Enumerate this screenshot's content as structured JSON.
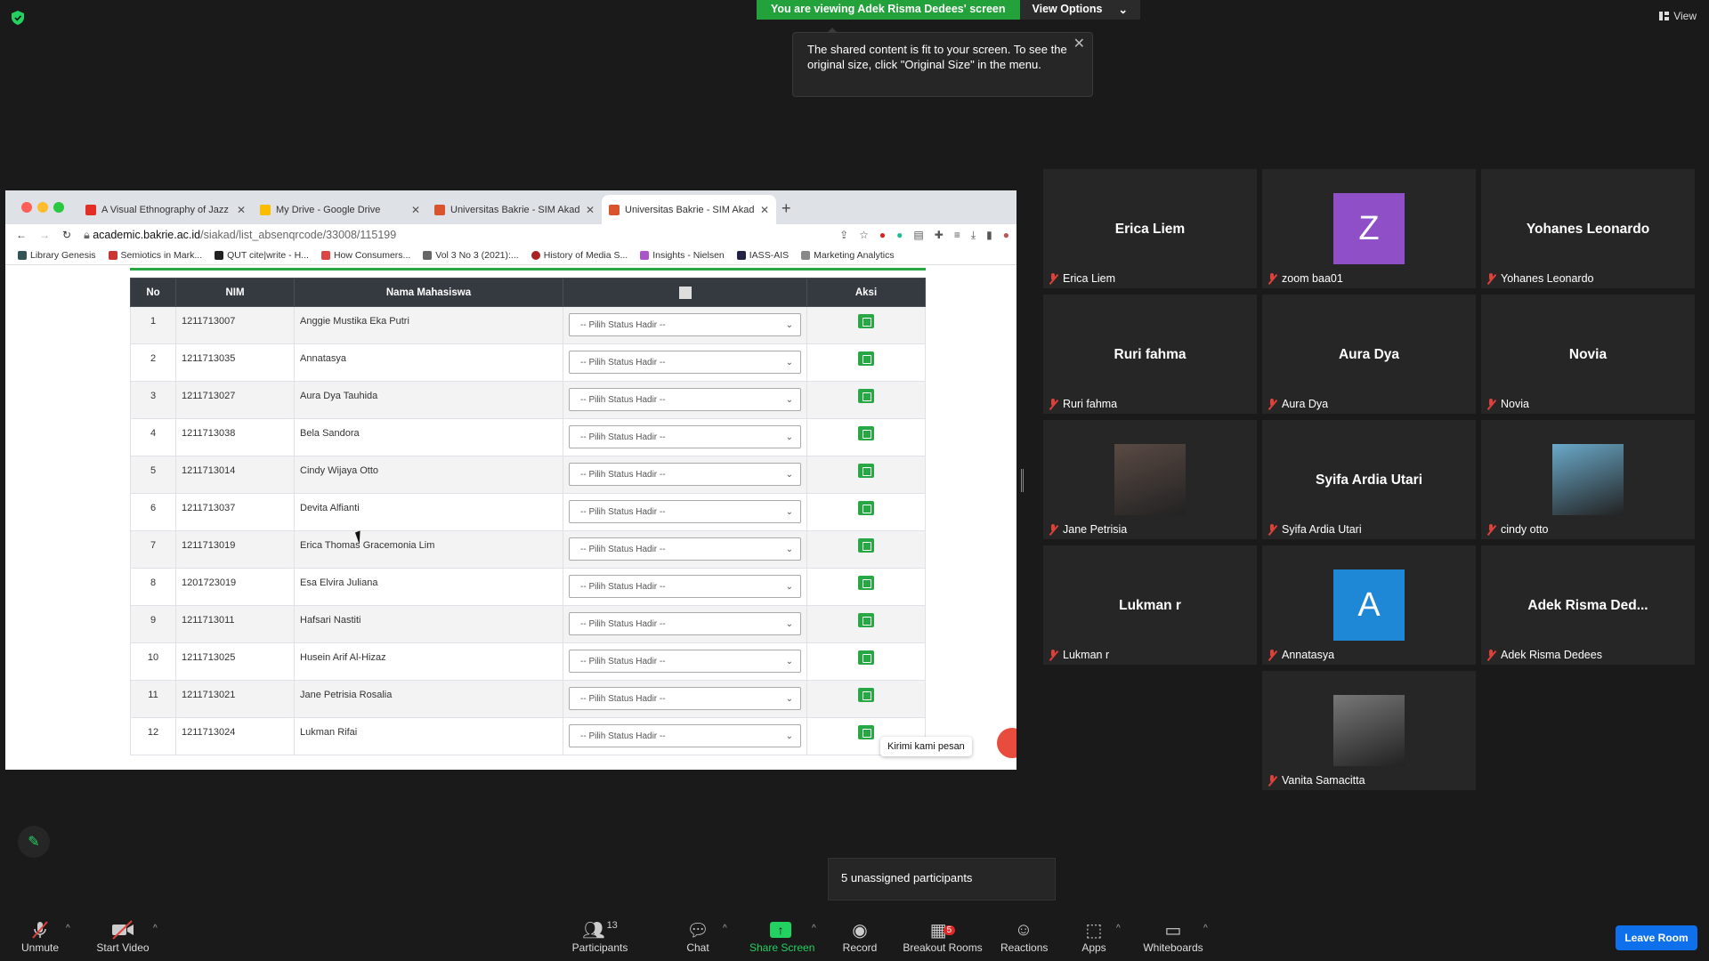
{
  "banner": {
    "viewing": "You are viewing Adek Risma Dedees' screen",
    "view_options": "View Options",
    "view_options_chevron": "⌄"
  },
  "tooltip": {
    "text": "The shared content is fit to your screen. To see the original size, click \"Original Size\" in the menu.",
    "close": "✕"
  },
  "view_button": {
    "label": "View"
  },
  "browser": {
    "tabs": [
      {
        "title": "A Visual Ethnography of Jazz C",
        "favicon_color": "#e52d27"
      },
      {
        "title": "My Drive - Google Drive",
        "favicon_color": "#fbbc04"
      },
      {
        "title": "Universitas Bakrie - SIM Akad",
        "favicon_color": "#d9532c"
      },
      {
        "title": "Universitas Bakrie - SIM Akad",
        "favicon_color": "#d9532c"
      }
    ],
    "url_host": "academic.bakrie.ac.id",
    "url_path": "/siakad/list_absenqrcode/33008/115199",
    "bookmarks": [
      "Library Genesis",
      "Semiotics in Mark...",
      "QUT cite|write - H...",
      "How Consumers...",
      "Vol 3 No 3 (2021):...",
      "History of Media S...",
      "Insights - Nielsen",
      "IASS-AIS",
      "Marketing Analytics"
    ]
  },
  "table": {
    "headers": [
      "No",
      "NIM",
      "Nama Mahasiswa",
      "",
      "Aksi"
    ],
    "select_placeholder": "-- Pilih Status Hadir --",
    "rows": [
      {
        "no": "1",
        "nim": "1211713007",
        "nama": "Anggie Mustika Eka Putri"
      },
      {
        "no": "2",
        "nim": "1211713035",
        "nama": "Annatasya"
      },
      {
        "no": "3",
        "nim": "1211713027",
        "nama": "Aura Dya Tauhida"
      },
      {
        "no": "4",
        "nim": "1211713038",
        "nama": "Bela Sandora"
      },
      {
        "no": "5",
        "nim": "1211713014",
        "nama": "Cindy Wijaya Otto"
      },
      {
        "no": "6",
        "nim": "1211713037",
        "nama": "Devita Alfianti"
      },
      {
        "no": "7",
        "nim": "1211713019",
        "nama": "Erica Thomas Gracemonia Lim"
      },
      {
        "no": "8",
        "nim": "1201723019",
        "nama": "Esa Elvira Juliana"
      },
      {
        "no": "9",
        "nim": "1211713011",
        "nama": "Hafsari Nastiti"
      },
      {
        "no": "10",
        "nim": "1211713025",
        "nama": "Husein Arif Al-Hizaz"
      },
      {
        "no": "11",
        "nim": "1211713021",
        "nama": "Jane Petrisia Rosalia"
      },
      {
        "no": "12",
        "nim": "1211713024",
        "nama": "Lukman Rifai"
      }
    ]
  },
  "chat_widget": {
    "label": "Kirimi kami pesan"
  },
  "participants": [
    {
      "display": "Erica Liem",
      "label": "Erica Liem",
      "kind": "name"
    },
    {
      "display": "Z",
      "label": "zoom baa01",
      "kind": "avatar",
      "color": "#8e4fc7"
    },
    {
      "display": "Yohanes Leonardo",
      "label": "Yohanes Leonardo",
      "kind": "name"
    },
    {
      "display": "Ruri fahma",
      "label": "Ruri fahma",
      "kind": "name"
    },
    {
      "display": "Aura Dya",
      "label": "Aura Dya",
      "kind": "name"
    },
    {
      "display": "Novia",
      "label": "Novia",
      "kind": "name"
    },
    {
      "display": "",
      "label": "Jane Petrisia",
      "kind": "photo",
      "color": "#5a4a44"
    },
    {
      "display": "Syifa Ardia Utari",
      "label": "Syifa Ardia Utari",
      "kind": "name"
    },
    {
      "display": "",
      "label": "cindy otto",
      "kind": "photo",
      "color": "#6aa9c9"
    },
    {
      "display": "Lukman r",
      "label": "Lukman r",
      "kind": "name"
    },
    {
      "display": "A",
      "label": "Annatasya",
      "kind": "avatar",
      "color": "#1e88d6"
    },
    {
      "display": "Adek Risma Ded...",
      "label": "Adek Risma Dedees",
      "kind": "name"
    },
    {
      "display": "",
      "label": "Vanita Samacitta",
      "kind": "photo",
      "color": "#777777"
    }
  ],
  "unassigned": "5 unassigned participants",
  "toolbar": {
    "unmute": "Unmute",
    "start_video": "Start Video",
    "participants": "Participants",
    "participants_count": "13",
    "chat": "Chat",
    "share_screen": "Share Screen",
    "record": "Record",
    "breakout_rooms": "Breakout Rooms",
    "breakout_badge": "5",
    "reactions": "Reactions",
    "apps": "Apps",
    "whiteboards": "Whiteboards",
    "leave": "Leave Room"
  }
}
